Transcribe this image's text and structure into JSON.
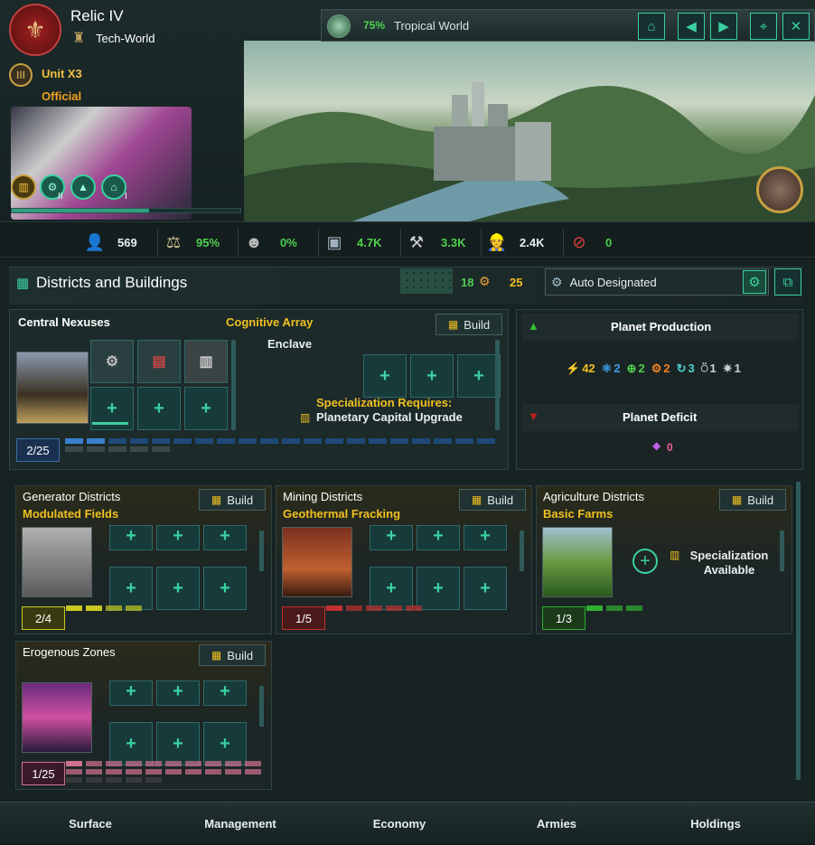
{
  "header": {
    "planet_name": "Relic IV",
    "planet_class": "Tech-World",
    "ruler": {
      "name": "Unit X3",
      "title": "Official",
      "level_badge": "III"
    },
    "traits": [
      "trait-1",
      "trait-2",
      "trait-3"
    ],
    "trait_levels": [
      "II",
      "I"
    ],
    "habitability": "75%",
    "world_type": "Tropical World"
  },
  "stats": [
    {
      "icon": "pop-icon",
      "value": "569",
      "color": "#e8eeee"
    },
    {
      "icon": "stability-icon",
      "value": "95%",
      "color": "#50d050"
    },
    {
      "icon": "crime-icon",
      "value": "0%",
      "color": "#50d050"
    },
    {
      "icon": "amenities-icon",
      "value": "4.7K",
      "color": "#50d050"
    },
    {
      "icon": "jobs-icon",
      "value": "3.3K",
      "color": "#50d050"
    },
    {
      "icon": "housing-icon",
      "value": "2.4K",
      "color": "#e8eeee"
    },
    {
      "icon": "devastation-icon",
      "value": "0",
      "color": "#50d050"
    }
  ],
  "districts_header": {
    "title": "Districts and Buildings",
    "building_slots": "18",
    "district_slots": "25",
    "designation": "Auto Designated"
  },
  "central": {
    "title": "Central Nexuses",
    "specialization": "Cognitive Array",
    "build_label": "Build",
    "count": "2/25",
    "enclave_label": "Enclave",
    "req_label": "Specialization Requires:",
    "req_value": "Planetary Capital Upgrade"
  },
  "production": {
    "title": "Planet Production",
    "deficit_title": "Planet Deficit",
    "items": [
      {
        "icon": "energy-icon",
        "value": "42",
        "color": "#f0c020"
      },
      {
        "icon": "research-icon",
        "value": "2",
        "color": "#40a0f0"
      },
      {
        "icon": "unity-icon",
        "value": "2",
        "color": "#50d050"
      },
      {
        "icon": "alloys-icon",
        "value": "2",
        "color": "#f08020"
      },
      {
        "icon": "trade-icon",
        "value": "3",
        "color": "#50d0d0"
      },
      {
        "icon": "influence-icon",
        "value": "1",
        "color": "#d0d0d0"
      },
      {
        "icon": "exotic-icon",
        "value": "1",
        "color": "#d0d0d0"
      }
    ],
    "deficit_value": "0"
  },
  "districts": [
    {
      "title": "Generator Districts",
      "specialization": "Modulated Fields",
      "count": "2/4",
      "build_label": "Build",
      "color": "#c8c820"
    },
    {
      "title": "Mining Districts",
      "specialization": "Geothermal Fracking",
      "count": "1/5",
      "build_label": "Build",
      "color": "#c03030"
    },
    {
      "title": "Agriculture Districts",
      "specialization": "Basic Farms",
      "count": "1/3",
      "build_label": "Build",
      "color": "#30b030",
      "spec_label": "Specialization Available"
    },
    {
      "title": "Erogenous Zones",
      "specialization": "",
      "count": "1/25",
      "build_label": "Build",
      "color": "#d07090"
    }
  ],
  "tabs": [
    "Surface",
    "Management",
    "Economy",
    "Armies",
    "Holdings"
  ]
}
